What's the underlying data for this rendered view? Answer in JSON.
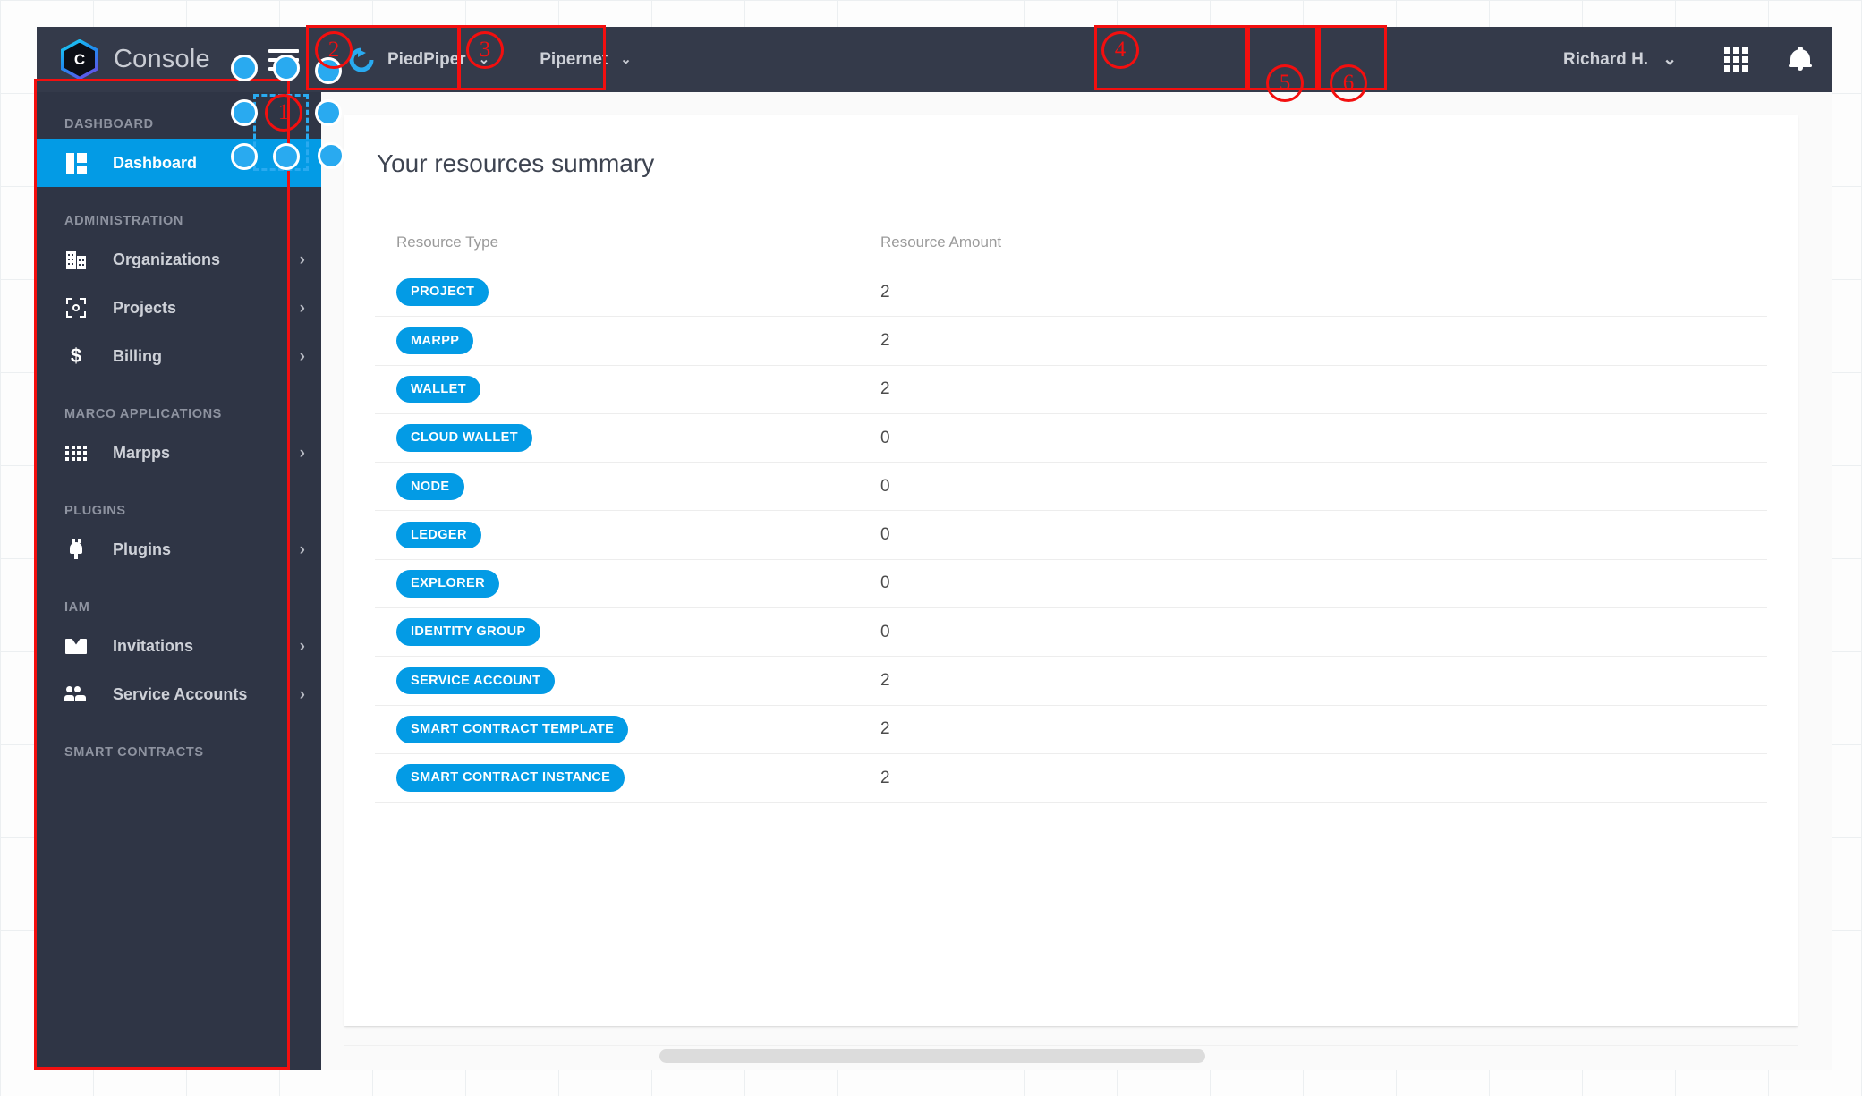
{
  "header": {
    "brand_title": "Console",
    "logo_letter": "C",
    "logo_icon": "hexagon-c-logo",
    "menu_icon": "hamburger-menu-icon",
    "org_selector": {
      "label": "PiedPiper",
      "icon": "organization-refresh-icon",
      "chevron": "⌄"
    },
    "network_selector": {
      "label": "Pipernet",
      "chevron": "⌄"
    },
    "user_menu": {
      "label": "Richard H.",
      "chevron": "⌄"
    },
    "apps_icon": "apps-grid-icon",
    "notifications_icon": "bell-notification-icon"
  },
  "sidebar": {
    "sections": [
      {
        "title": "DASHBOARD",
        "items": [
          {
            "label": "Dashboard",
            "icon": "dashboard-grid-icon",
            "active": true,
            "arrow": ""
          }
        ]
      },
      {
        "title": "ADMINISTRATION",
        "items": [
          {
            "label": "Organizations",
            "icon": "building-icon",
            "active": false,
            "arrow": "›"
          },
          {
            "label": "Projects",
            "icon": "project-frame-icon",
            "active": false,
            "arrow": "›"
          },
          {
            "label": "Billing",
            "icon": "dollar-icon",
            "active": false,
            "arrow": "›"
          }
        ]
      },
      {
        "title": "MARCO APPLICATIONS",
        "items": [
          {
            "label": "Marpps",
            "icon": "apps-dots-icon",
            "active": false,
            "arrow": "›"
          }
        ]
      },
      {
        "title": "PLUGINS",
        "items": [
          {
            "label": "Plugins",
            "icon": "plug-icon",
            "active": false,
            "arrow": "›"
          }
        ]
      },
      {
        "title": "IAM",
        "items": [
          {
            "label": "Invitations",
            "icon": "envelope-icon",
            "active": false,
            "arrow": "›"
          },
          {
            "label": "Service Accounts",
            "icon": "people-icon",
            "active": false,
            "arrow": "›"
          }
        ]
      },
      {
        "title": "SMART CONTRACTS",
        "items": []
      }
    ]
  },
  "main": {
    "card_title": "Your resources summary",
    "table": {
      "columns": [
        "Resource Type",
        "Resource Amount"
      ],
      "rows": [
        {
          "type": "PROJECT",
          "amount": "2"
        },
        {
          "type": "MARPP",
          "amount": "2"
        },
        {
          "type": "WALLET",
          "amount": "2"
        },
        {
          "type": "CLOUD WALLET",
          "amount": "0"
        },
        {
          "type": "NODE",
          "amount": "0"
        },
        {
          "type": "LEDGER",
          "amount": "0"
        },
        {
          "type": "EXPLORER",
          "amount": "0"
        },
        {
          "type": "IDENTITY GROUP",
          "amount": "0"
        },
        {
          "type": "SERVICE ACCOUNT",
          "amount": "2"
        },
        {
          "type": "SMART CONTRACT TEMPLATE",
          "amount": "2"
        },
        {
          "type": "SMART CONTRACT INSTANCE",
          "amount": "2"
        }
      ]
    }
  },
  "annotations": {
    "markers": [
      {
        "id": "1",
        "label": "1"
      },
      {
        "id": "2",
        "label": "2"
      },
      {
        "id": "3",
        "label": "3"
      },
      {
        "id": "4",
        "label": "4"
      },
      {
        "id": "5",
        "label": "5"
      },
      {
        "id": "6",
        "label": "6"
      }
    ]
  },
  "colors": {
    "header_bg": "#343a4a",
    "sidebar_bg": "#2f3545",
    "accent_blue": "#039be5",
    "marker_red": "#f30f0f",
    "dot_blue": "#29aaf0"
  }
}
